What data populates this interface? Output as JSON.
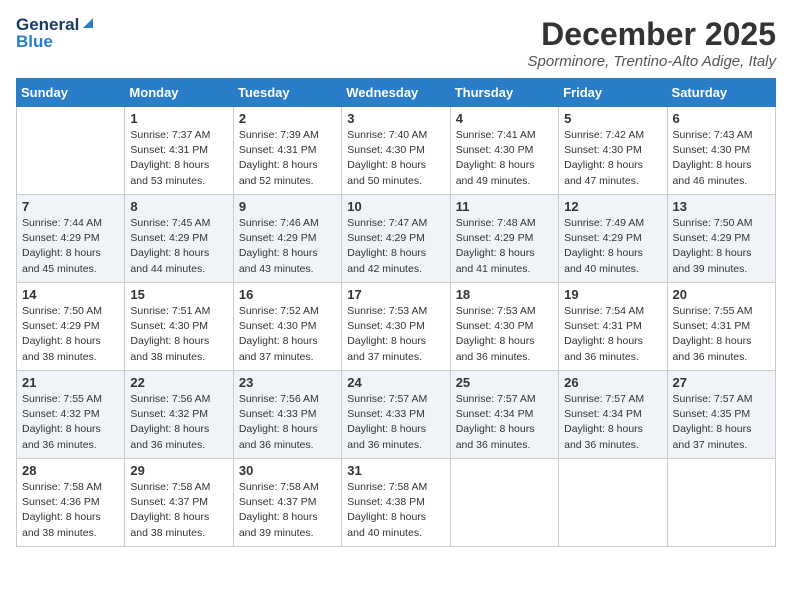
{
  "header": {
    "logo_general": "General",
    "logo_blue": "Blue",
    "title": "December 2025",
    "location": "Sporminore, Trentino-Alto Adige, Italy"
  },
  "days_of_week": [
    "Sunday",
    "Monday",
    "Tuesday",
    "Wednesday",
    "Thursday",
    "Friday",
    "Saturday"
  ],
  "weeks": [
    [
      {
        "day": "",
        "info": ""
      },
      {
        "day": "1",
        "info": "Sunrise: 7:37 AM\nSunset: 4:31 PM\nDaylight: 8 hours\nand 53 minutes."
      },
      {
        "day": "2",
        "info": "Sunrise: 7:39 AM\nSunset: 4:31 PM\nDaylight: 8 hours\nand 52 minutes."
      },
      {
        "day": "3",
        "info": "Sunrise: 7:40 AM\nSunset: 4:30 PM\nDaylight: 8 hours\nand 50 minutes."
      },
      {
        "day": "4",
        "info": "Sunrise: 7:41 AM\nSunset: 4:30 PM\nDaylight: 8 hours\nand 49 minutes."
      },
      {
        "day": "5",
        "info": "Sunrise: 7:42 AM\nSunset: 4:30 PM\nDaylight: 8 hours\nand 47 minutes."
      },
      {
        "day": "6",
        "info": "Sunrise: 7:43 AM\nSunset: 4:30 PM\nDaylight: 8 hours\nand 46 minutes."
      }
    ],
    [
      {
        "day": "7",
        "info": "Sunrise: 7:44 AM\nSunset: 4:29 PM\nDaylight: 8 hours\nand 45 minutes."
      },
      {
        "day": "8",
        "info": "Sunrise: 7:45 AM\nSunset: 4:29 PM\nDaylight: 8 hours\nand 44 minutes."
      },
      {
        "day": "9",
        "info": "Sunrise: 7:46 AM\nSunset: 4:29 PM\nDaylight: 8 hours\nand 43 minutes."
      },
      {
        "day": "10",
        "info": "Sunrise: 7:47 AM\nSunset: 4:29 PM\nDaylight: 8 hours\nand 42 minutes."
      },
      {
        "day": "11",
        "info": "Sunrise: 7:48 AM\nSunset: 4:29 PM\nDaylight: 8 hours\nand 41 minutes."
      },
      {
        "day": "12",
        "info": "Sunrise: 7:49 AM\nSunset: 4:29 PM\nDaylight: 8 hours\nand 40 minutes."
      },
      {
        "day": "13",
        "info": "Sunrise: 7:50 AM\nSunset: 4:29 PM\nDaylight: 8 hours\nand 39 minutes."
      }
    ],
    [
      {
        "day": "14",
        "info": "Sunrise: 7:50 AM\nSunset: 4:29 PM\nDaylight: 8 hours\nand 38 minutes."
      },
      {
        "day": "15",
        "info": "Sunrise: 7:51 AM\nSunset: 4:30 PM\nDaylight: 8 hours\nand 38 minutes."
      },
      {
        "day": "16",
        "info": "Sunrise: 7:52 AM\nSunset: 4:30 PM\nDaylight: 8 hours\nand 37 minutes."
      },
      {
        "day": "17",
        "info": "Sunrise: 7:53 AM\nSunset: 4:30 PM\nDaylight: 8 hours\nand 37 minutes."
      },
      {
        "day": "18",
        "info": "Sunrise: 7:53 AM\nSunset: 4:30 PM\nDaylight: 8 hours\nand 36 minutes."
      },
      {
        "day": "19",
        "info": "Sunrise: 7:54 AM\nSunset: 4:31 PM\nDaylight: 8 hours\nand 36 minutes."
      },
      {
        "day": "20",
        "info": "Sunrise: 7:55 AM\nSunset: 4:31 PM\nDaylight: 8 hours\nand 36 minutes."
      }
    ],
    [
      {
        "day": "21",
        "info": "Sunrise: 7:55 AM\nSunset: 4:32 PM\nDaylight: 8 hours\nand 36 minutes."
      },
      {
        "day": "22",
        "info": "Sunrise: 7:56 AM\nSunset: 4:32 PM\nDaylight: 8 hours\nand 36 minutes."
      },
      {
        "day": "23",
        "info": "Sunrise: 7:56 AM\nSunset: 4:33 PM\nDaylight: 8 hours\nand 36 minutes."
      },
      {
        "day": "24",
        "info": "Sunrise: 7:57 AM\nSunset: 4:33 PM\nDaylight: 8 hours\nand 36 minutes."
      },
      {
        "day": "25",
        "info": "Sunrise: 7:57 AM\nSunset: 4:34 PM\nDaylight: 8 hours\nand 36 minutes."
      },
      {
        "day": "26",
        "info": "Sunrise: 7:57 AM\nSunset: 4:34 PM\nDaylight: 8 hours\nand 36 minutes."
      },
      {
        "day": "27",
        "info": "Sunrise: 7:57 AM\nSunset: 4:35 PM\nDaylight: 8 hours\nand 37 minutes."
      }
    ],
    [
      {
        "day": "28",
        "info": "Sunrise: 7:58 AM\nSunset: 4:36 PM\nDaylight: 8 hours\nand 38 minutes."
      },
      {
        "day": "29",
        "info": "Sunrise: 7:58 AM\nSunset: 4:37 PM\nDaylight: 8 hours\nand 38 minutes."
      },
      {
        "day": "30",
        "info": "Sunrise: 7:58 AM\nSunset: 4:37 PM\nDaylight: 8 hours\nand 39 minutes."
      },
      {
        "day": "31",
        "info": "Sunrise: 7:58 AM\nSunset: 4:38 PM\nDaylight: 8 hours\nand 40 minutes."
      },
      {
        "day": "",
        "info": ""
      },
      {
        "day": "",
        "info": ""
      },
      {
        "day": "",
        "info": ""
      }
    ]
  ]
}
